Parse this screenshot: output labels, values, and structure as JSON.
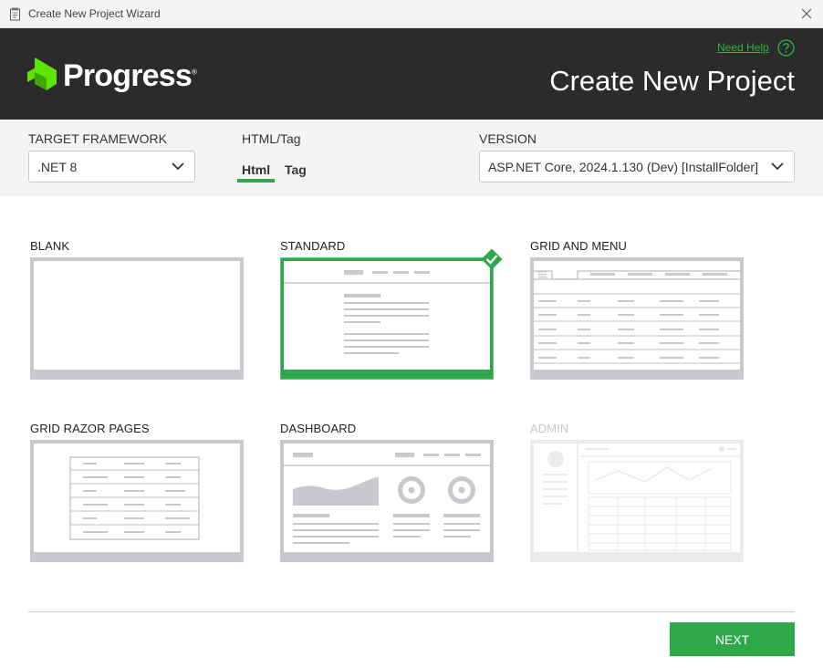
{
  "window": {
    "title": "Create New Project Wizard"
  },
  "header": {
    "logo_text": "Progress",
    "logo_reg": "®",
    "need_help": "Need Help",
    "title": "Create New Project"
  },
  "config": {
    "framework_label": "TARGET FRAMEWORK",
    "framework_value": ".NET 8",
    "htmltag_label": "HTML/Tag",
    "tab_html": "Html",
    "tab_tag": "Tag",
    "version_label": "VERSION",
    "version_value": "ASP.NET Core, 2024.1.130 (Dev) [InstallFolder]"
  },
  "templates": [
    {
      "label": "BLANK",
      "selected": false,
      "enabled": true
    },
    {
      "label": "STANDARD",
      "selected": true,
      "enabled": true
    },
    {
      "label": "GRID AND MENU",
      "selected": false,
      "enabled": true
    },
    {
      "label": "GRID RAZOR PAGES",
      "selected": false,
      "enabled": true
    },
    {
      "label": "DASHBOARD",
      "selected": false,
      "enabled": true
    },
    {
      "label": "ADMIN",
      "selected": false,
      "enabled": false
    }
  ],
  "footer": {
    "next_label": "NEXT"
  },
  "colors": {
    "accent": "#2ea84a",
    "header_bg": "#2b2b2b",
    "thumb_frame": "#c7c9cc"
  }
}
